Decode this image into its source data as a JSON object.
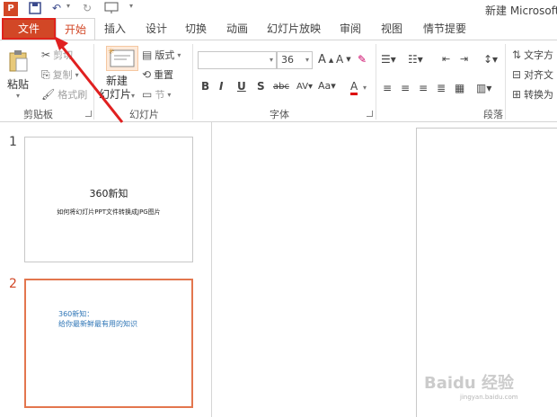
{
  "titlebar": {
    "app_icon": "powerpoint-icon",
    "title": "新建 Microsoft"
  },
  "tabs": [
    {
      "label": "文件"
    },
    {
      "label": "开始"
    },
    {
      "label": "插入"
    },
    {
      "label": "设计"
    },
    {
      "label": "切换"
    },
    {
      "label": "动画"
    },
    {
      "label": "幻灯片放映"
    },
    {
      "label": "审阅"
    },
    {
      "label": "视图"
    },
    {
      "label": "情节提要"
    }
  ],
  "ribbon": {
    "clipboard": {
      "paste": "粘贴",
      "cut": "剪切",
      "copy": "复制",
      "format_painter": "格式刷",
      "label": "剪贴板"
    },
    "slides": {
      "new_slide_line1": "新建",
      "new_slide_line2": "幻灯片",
      "layout": "版式",
      "reset": "重置",
      "section": "节",
      "label": "幻灯片"
    },
    "font": {
      "font_name": "",
      "font_size": "36",
      "label": "字体"
    },
    "paragraph": {
      "text_direction": "文字方",
      "align_text": "对齐文",
      "convert": "转换为",
      "label": "段落"
    }
  },
  "slides": [
    {
      "number": "1",
      "title": "360新知",
      "subtitle": "如何将幻灯片PPT文件转换成JPG图片"
    },
    {
      "number": "2",
      "line1": "360新知：",
      "line2": "给你最新鲜最有用的知识"
    }
  ],
  "watermark": {
    "text": "Baidu 经验",
    "sub": "jingyan.baidu.com"
  }
}
